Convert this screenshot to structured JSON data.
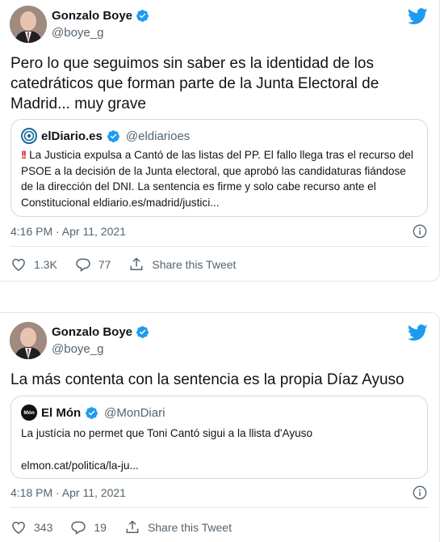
{
  "tweets": [
    {
      "author": {
        "name": "Gonzalo Boye",
        "handle": "@boye_g"
      },
      "text": "Pero lo que seguimos sin saber es la identidad de los catedráticos que forman parte de la Junta Electoral de Madrid... muy grave",
      "quote": {
        "name": "elDiario.es",
        "handle": "@eldiarioes",
        "prefix": "!!",
        "body": "La Justicia expulsa a Cantó de las listas del PP. El fallo llega tras el recurso del PSOE a la decisión de la Junta electoral, que aprobó las candidaturas fiándose de la dirección del DNI. La sentencia es firme y solo cabe recurso ante el Constitucional eldiario.es/madrid/justici..."
      },
      "timestamp": "4:16 PM · Apr 11, 2021",
      "likes": "1.3K",
      "replies": "77",
      "share_label": "Share this Tweet"
    },
    {
      "author": {
        "name": "Gonzalo Boye",
        "handle": "@boye_g"
      },
      "text": "La más contenta con la sentencia es la propia Díaz Ayuso",
      "quote": {
        "name": "El Món",
        "avatar_text": "Món",
        "handle": "@MonDiari",
        "body": "La justícia no permet que Toni Cantó sigui a la llista d'Ayuso",
        "link": "elmon.cat/politica/la-ju..."
      },
      "timestamp": "4:18 PM · Apr 11, 2021",
      "likes": "343",
      "replies": "19",
      "share_label": "Share this Tweet"
    }
  ],
  "colors": {
    "twitter_blue": "#1d9bf0",
    "muted": "#536471",
    "border": "#cfd9de",
    "alert_red": "#d8232a"
  }
}
